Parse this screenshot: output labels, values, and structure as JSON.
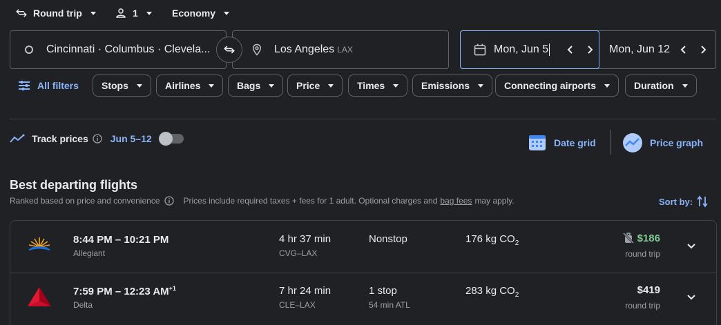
{
  "top": {
    "trip_type": "Round trip",
    "passengers": "1",
    "cabin": "Economy"
  },
  "search": {
    "origin": "Cincinnati · Columbus · Clevela...",
    "destination": "Los Angeles",
    "destination_code": "LAX",
    "depart_date": "Mon, Jun 5",
    "return_date": "Mon, Jun 12"
  },
  "filters": {
    "all_filters": "All filters",
    "chips": [
      "Stops",
      "Airlines",
      "Bags",
      "Price",
      "Times",
      "Emissions",
      "Connecting airports",
      "Duration"
    ]
  },
  "track": {
    "label": "Track prices",
    "range": "Jun 5–12"
  },
  "tools": {
    "date_grid": "Date grid",
    "price_graph": "Price graph"
  },
  "section": {
    "title": "Best departing flights",
    "ranked": "Ranked based on price and convenience",
    "taxes_pre": "Prices include required taxes + fees for 1 adult. Optional charges and",
    "bag_fees": "bag fees",
    "taxes_post": "may apply.",
    "sort_label": "Sort by:"
  },
  "flights": [
    {
      "time": "8:44 PM – 10:21 PM",
      "time_suffix": "",
      "airline": "Allegiant",
      "duration": "4 hr 37 min",
      "route": "CVG–LAX",
      "stops": "Nonstop",
      "stop_detail": "",
      "emissions": "176 kg CO",
      "emissions_sub": "2",
      "price": "$186",
      "price_color": "#81c995",
      "price_note": "round trip"
    },
    {
      "time": "7:59 PM – 12:23 AM",
      "time_suffix": "+1",
      "airline": "Delta",
      "duration": "7 hr 24 min",
      "route": "CLE–LAX",
      "stops": "1 stop",
      "stop_detail": "54 min ATL",
      "emissions": "283 kg CO",
      "emissions_sub": "2",
      "price": "$419",
      "price_color": "#e8eaed",
      "price_note": "round trip"
    }
  ],
  "colors": {
    "accent": "#8ab4f8",
    "background": "#202124",
    "border": "#5f6368"
  }
}
